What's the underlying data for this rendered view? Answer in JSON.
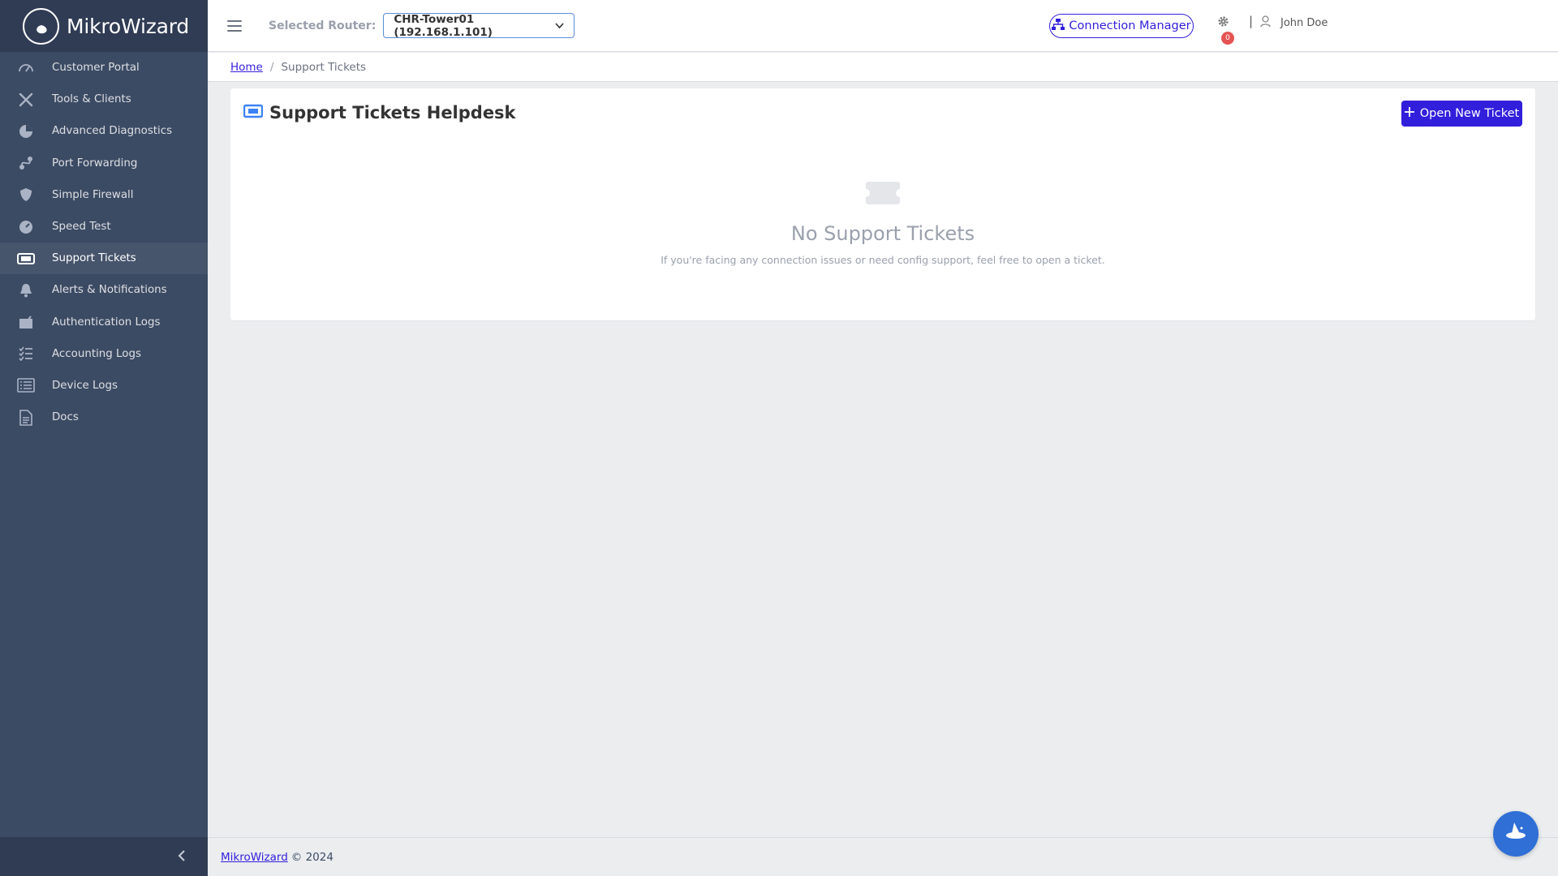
{
  "brand": {
    "name": "MikroWizard"
  },
  "sidebar": {
    "items": [
      {
        "label": "Customer Portal",
        "icon": "speedometer-icon"
      },
      {
        "label": "Tools & Clients",
        "icon": "tools-icon"
      },
      {
        "label": "Advanced Diagnostics",
        "icon": "chart-pie-icon"
      },
      {
        "label": "Port Forwarding",
        "icon": "route-icon"
      },
      {
        "label": "Simple Firewall",
        "icon": "shield-icon"
      },
      {
        "label": "Speed Test",
        "icon": "gauge-icon"
      },
      {
        "label": "Support Tickets",
        "icon": "ticket-icon",
        "active": true
      },
      {
        "label": "Alerts & Notifications",
        "icon": "bell-icon"
      },
      {
        "label": "Authentication Logs",
        "icon": "inbox-check-icon"
      },
      {
        "label": "Accounting Logs",
        "icon": "list-check-icon"
      },
      {
        "label": "Device Logs",
        "icon": "list-icon"
      },
      {
        "label": "Docs",
        "icon": "document-icon"
      }
    ]
  },
  "header": {
    "router_label": "Selected Router:",
    "router_value": "CHR-Tower01 (192.168.1.101)",
    "connection_manager": "Connection Manager",
    "notification_count": "0",
    "separator": "|",
    "user_name": "John Doe"
  },
  "breadcrumb": {
    "home": "Home",
    "separator": "/",
    "current": "Support Tickets"
  },
  "card": {
    "title": "Support Tickets Helpdesk",
    "new_ticket_label": "Open New Ticket",
    "empty_title": "No Support Tickets",
    "empty_subtitle": "If you're facing any connection issues or need config support, feel free to open a ticket."
  },
  "footer": {
    "link": "MikroWizard",
    "copyright": "© 2024"
  },
  "colors": {
    "sidebar": "#3c4b64",
    "primary": "#321fdb",
    "badge": "#e55353",
    "fab": "#2f6fd6"
  }
}
